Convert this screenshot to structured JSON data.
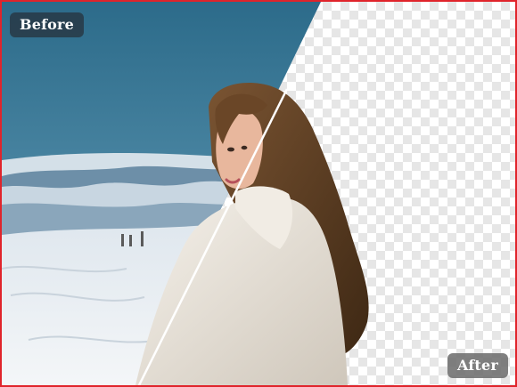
{
  "comparison": {
    "before_label": "Before",
    "after_label": "After"
  },
  "colors": {
    "frame_border": "#e0242b",
    "sky_top": "#2f6f8d",
    "sky_bottom": "#a9c8d8",
    "snow": "#edf1f4",
    "mountains": "#6d8fa8",
    "hair": "#5b3c22",
    "coat": "#ece6dc",
    "skin": "#e9b9a0",
    "checker_light": "#ffffff",
    "checker_dark": "#e6e6e6",
    "divider": "#ffffff"
  },
  "icons": {
    "before_scene": "snowy-mountain-photo",
    "after_scene": "transparent-background-checkerboard"
  }
}
